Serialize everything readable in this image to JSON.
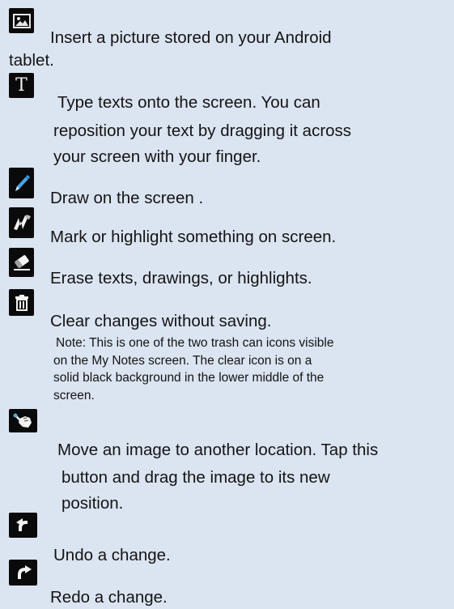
{
  "items": [
    {
      "icon": "picture-icon",
      "text": "Insert a picture stored on your Android tablet."
    },
    {
      "icon": "text-t-icon",
      "text": "Type texts onto the screen. You can reposition your text by dragging it across your screen with your finger."
    },
    {
      "icon": "pen-icon",
      "text": "Draw on the screen ."
    },
    {
      "icon": "highlighter-icon",
      "text": "Mark or highlight something on screen."
    },
    {
      "icon": "eraser-icon",
      "text": "Erase texts, drawings, or highlights."
    },
    {
      "icon": "trash-can-icon",
      "text": "Clear changes without saving.",
      "note": "Note: This is one of the two trash can icons visible on the My Notes screen. The clear icon is on a solid black background in the lower middle of the screen."
    },
    {
      "icon": "hand-move-icon",
      "text": "Move an image to another location. Tap this button and drag the image to its new position."
    },
    {
      "icon": "undo-icon",
      "text": "Undo a change."
    },
    {
      "icon": "redo-icon",
      "text": "Redo a change."
    }
  ],
  "lines": {
    "picture_1": "Insert a picture stored on your Android",
    "picture_2": "tablet.",
    "text_1": "Type texts onto the screen. You can",
    "text_2": "reposition your text by dragging it across",
    "text_3": "your screen with your finger.",
    "move_1": "Move an image to another location. Tap this",
    "move_2": "button and drag the image to its new",
    "move_3": "position.",
    "note_1": "Note: This is one of the two trash can icons visible",
    "note_2": "on the My Notes screen. The clear icon is on a",
    "note_3": "solid black background in the lower middle of the",
    "note_4": "screen."
  },
  "colors": {
    "background": "#dbe4f1",
    "icon_bg": "#0a0a0a",
    "pen_blue": "#4aa3e8"
  }
}
